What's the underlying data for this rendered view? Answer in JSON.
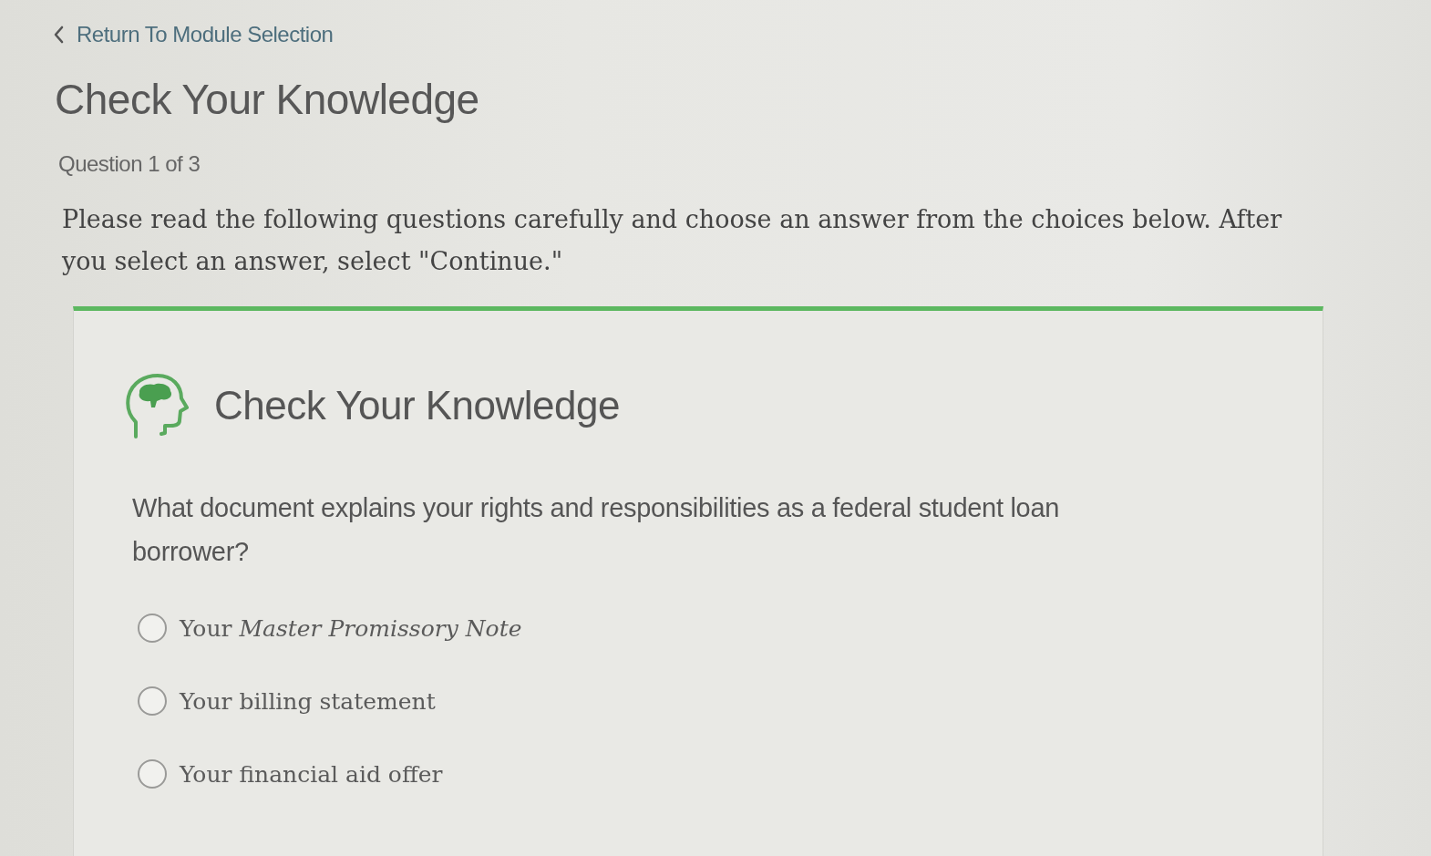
{
  "back_link": {
    "label": "Return To Module Selection"
  },
  "title": "Check Your Knowledge",
  "progress": "Question 1 of 3",
  "instructions": "Please read the following questions carefully and choose an answer from the choices below. After you select an answer, select \"Continue.\"",
  "card": {
    "heading": "Check Your Knowledge",
    "question": "What document explains your rights and responsibilities as a federal student loan borrower?",
    "options": [
      {
        "label": "Your *Master Promissory Note*",
        "selected": false
      },
      {
        "label": "Your billing statement",
        "selected": false
      },
      {
        "label": "Your financial aid offer",
        "selected": false
      }
    ]
  }
}
